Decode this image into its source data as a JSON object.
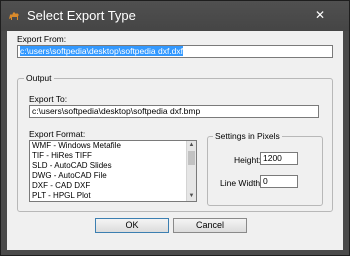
{
  "window": {
    "title": "Select Export Type",
    "close_glyph": "✕",
    "app_icon": "camel-icon"
  },
  "export_from": {
    "label": "Export From:",
    "value": "c:\\users\\softpedia\\desktop\\softpedia dxf.dxf"
  },
  "output_group": {
    "label": "Output",
    "export_to_label": "Export To:",
    "export_to_value": "c:\\users\\softpedia\\desktop\\softpedia dxf.bmp",
    "format_label": "Export Format:",
    "formats": [
      "WMF - Windows Metafile",
      "TIF - HiRes TIFF",
      "SLD - AutoCAD Slides",
      "DWG - AutoCAD File",
      "DXF - CAD DXF",
      "PLT - HPGL Plot"
    ]
  },
  "settings_group": {
    "label": "Settings in Pixels",
    "height_label": "Height:",
    "height_value": "1200",
    "linewidth_label": "Line Width:",
    "linewidth_value": "0"
  },
  "buttons": {
    "ok": "OK",
    "cancel": "Cancel"
  }
}
